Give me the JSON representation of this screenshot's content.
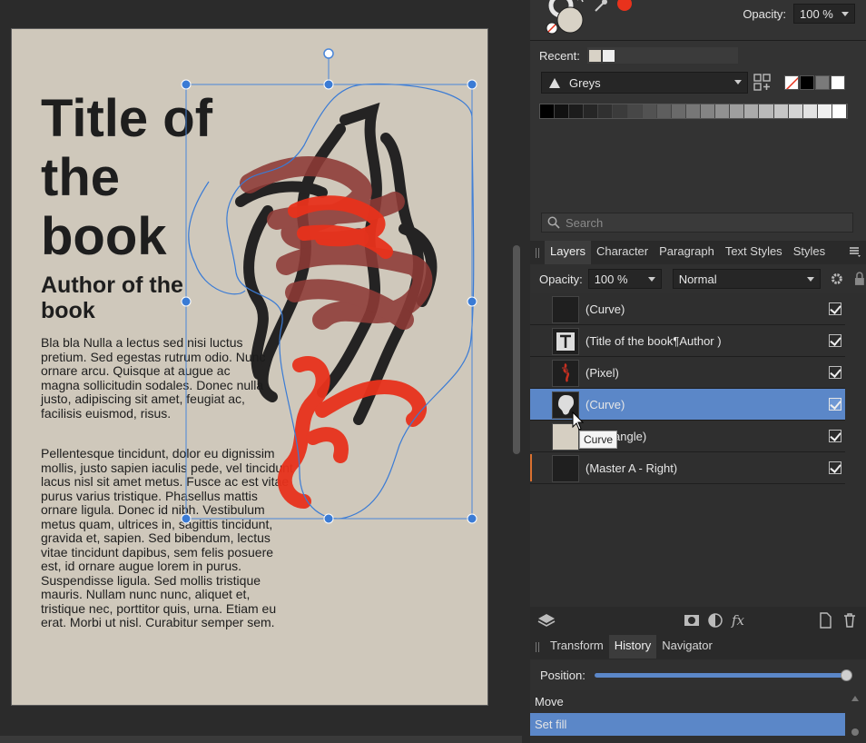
{
  "document": {
    "title": "Title of the book",
    "author": "Author of the book",
    "paragraph1": "Bla bla Nulla a lectus sed nisi luctus pretium. Sed egestas rutrum odio. Nunc ornare arcu. Quisque at augue ac magna sollicitudin sodales. Donec nulla justo, adipiscing sit amet, feugiat ac, facilisis euismod, risus.",
    "paragraph2": "Pellentesque tincidunt, dolor eu dignissim mollis, justo sapien iaculis pede, vel tincidunt lacus nisl sit amet metus. Fusce ac est vitae purus varius tristique. Phasellus mattis ornare ligula. Donec id nibh. Vestibulum metus quam, ultrices in, sagittis tincidunt, gravida et, sapien. Sed bibendum, lectus vitae tincidunt dapibus, sem felis posuere est, id ornare augue lorem in purus. Suspendisse ligula. Sed mollis tristique mauris. Nullam nunc nunc, aliquet et, tristique nec, porttitor quis, urna. Etiam eu erat. Morbi ut nisl. Curabitur semper sem."
  },
  "color_panel": {
    "opacity_label": "Opacity:",
    "opacity_value": "100 %",
    "recent_label": "Recent:",
    "palette_name": "Greys",
    "accent_color": "#e8321c",
    "greys": [
      "#000000",
      "#111111",
      "#1c1c1c",
      "#262626",
      "#303030",
      "#3b3b3b",
      "#474747",
      "#525252",
      "#5e5e5e",
      "#6a6a6a",
      "#777777",
      "#848484",
      "#919191",
      "#9e9e9e",
      "#ababab",
      "#b9b9b9",
      "#c6c6c6",
      "#d4d4d4",
      "#e2e2e2",
      "#f0f0f0",
      "#ffffff"
    ]
  },
  "search": {
    "placeholder": "Search"
  },
  "layers_panel": {
    "tabs": [
      "Layers",
      "Character",
      "Paragraph",
      "Text Styles",
      "Styles"
    ],
    "active_tab": "Layers",
    "opacity_label": "Opacity:",
    "opacity_value": "100 %",
    "blend_mode": "Normal",
    "layers": [
      {
        "name": "(Curve)",
        "thumb": "dark",
        "visible": true,
        "selected": false
      },
      {
        "name": "(Title of the book¶Author )",
        "thumb": "text",
        "visible": true,
        "selected": false
      },
      {
        "name": "(Pixel)",
        "thumb": "pixel",
        "visible": true,
        "selected": false
      },
      {
        "name": "(Curve)",
        "thumb": "curve-shape",
        "visible": true,
        "selected": true
      },
      {
        "name": "(Rectangle)",
        "thumb": "beige",
        "visible": true,
        "selected": false
      },
      {
        "name": "(Master A - Right)",
        "thumb": "dark",
        "visible": true,
        "selected": false
      }
    ],
    "tooltip": "Curve",
    "selection_color": "#5b87c8"
  },
  "history_panel": {
    "tabs": [
      "Transform",
      "History",
      "Navigator"
    ],
    "active_tab": "History",
    "position_label": "Position:",
    "items": [
      "Move",
      "Set fill"
    ],
    "selected_item": "Set fill"
  }
}
